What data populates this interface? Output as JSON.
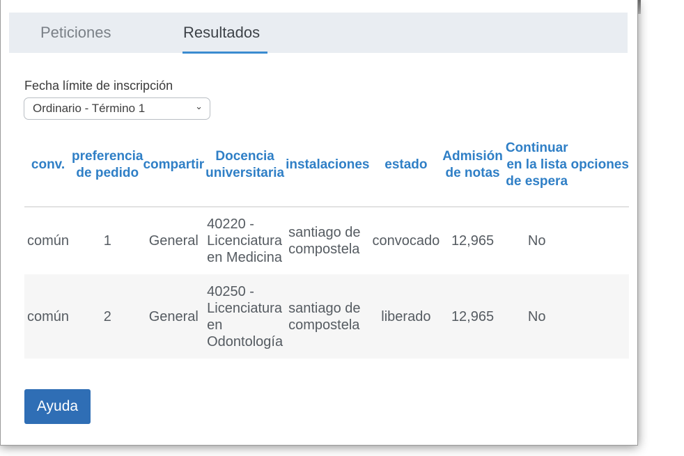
{
  "tabs": [
    {
      "label": "Peticiones",
      "active": false
    },
    {
      "label": "Resultados",
      "active": true
    }
  ],
  "filter": {
    "label": "Fecha límite de inscripción",
    "selected": "Ordinario - Término 1"
  },
  "table": {
    "headers": {
      "conv": "conv.",
      "preferencia": "preferencia de pedido",
      "compartir": "compartir",
      "docencia": "Docencia universitaria",
      "instalaciones": "instalaciones",
      "estado": "estado",
      "admision": "Admisión de notas",
      "continuar": "Continuar en la lista de espera",
      "opciones": "opciones"
    },
    "rows": [
      {
        "conv": "común",
        "preferencia": "1",
        "compartir": "General",
        "docencia": "40220 - Licenciatura en Medicina",
        "instalaciones": "santiago de compostela",
        "estado": "convocado",
        "admision": "12,965",
        "continuar": "No",
        "opciones": ""
      },
      {
        "conv": "común",
        "preferencia": "2",
        "compartir": "General",
        "docencia": "40250 - Licenciatura en Odontología",
        "instalaciones": "santiago de compostela",
        "estado": "liberado",
        "admision": "12,965",
        "continuar": "No",
        "opciones": ""
      }
    ]
  },
  "help_button": {
    "label": "Ayuda"
  },
  "colors": {
    "accent": "#2f7fc6",
    "button": "#2f6eb5",
    "tab_bar": "#e9edf2",
    "underline": "#3a8bd0"
  }
}
